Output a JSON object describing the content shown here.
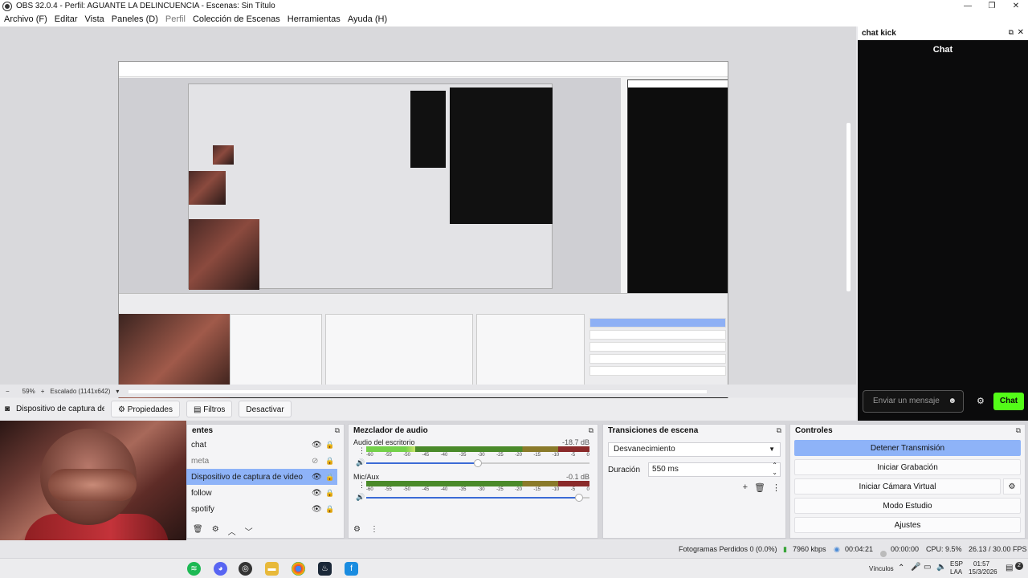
{
  "window": {
    "title": "OBS 32.0.4 - Perfil: AGUANTE LA DELINCUENCIA - Escenas: Sin Título",
    "controls": [
      "—",
      "❐",
      "✕"
    ]
  },
  "menu": {
    "items": [
      "Archivo (F)",
      "Editar",
      "Vista",
      "Paneles (D)",
      "Perfil",
      "Colección de Escenas",
      "Herramientas",
      "Ayuda (H)"
    ]
  },
  "preview": {
    "zoom": "59%",
    "scale": "Escalado (1141x642)"
  },
  "chat_dock": {
    "header": "chat kick",
    "title": "Chat",
    "input_placeholder": "Enviar un mensaje",
    "send_label": "Chat"
  },
  "source_toolbar": {
    "source_name": "Dispositivo de captura de v",
    "properties": "Propiedades",
    "filters": "Filtros",
    "deactivate": "Desactivar"
  },
  "sources": {
    "header": "entes",
    "items": [
      {
        "name": "chat",
        "visible": true
      },
      {
        "name": "meta",
        "visible": false
      },
      {
        "name": "Dispositivo de captura de video",
        "visible": true,
        "selected": true
      },
      {
        "name": "follow",
        "visible": true
      },
      {
        "name": "spotify",
        "visible": true
      }
    ]
  },
  "mixer": {
    "header": "Mezclador de audio",
    "tracks": [
      {
        "name": "Audio del escritorio",
        "db": "-18.7 dB",
        "level": 0.22,
        "volume": 0.5
      },
      {
        "name": "Mic/Aux",
        "db": "-0.1 dB",
        "level": 0.0,
        "volume": 0.97
      }
    ],
    "ticks": [
      "-60",
      "-55",
      "-50",
      "-45",
      "-40",
      "-35",
      "-30",
      "-25",
      "-20",
      "-15",
      "-10",
      "-5",
      "0"
    ]
  },
  "transitions": {
    "header": "Transiciones de escena",
    "selected": "Desvanecimiento",
    "duration_label": "Duración",
    "duration_value": "550 ms"
  },
  "controls": {
    "header": "Controles",
    "stop_stream": "Detener Transmisión",
    "start_record": "Iniciar Grabación",
    "start_virtualcam": "Iniciar Cámara Virtual",
    "studio_mode": "Modo Estudio",
    "settings": "Ajustes"
  },
  "status": {
    "dropped": "Fotogramas Perdidos 0 (0.0%)",
    "bitrate": "7960 kbps",
    "stream_time": "00:04:21",
    "rec_time": "00:00:00",
    "cpu": "CPU: 9.5%",
    "fps": "26.13 / 30.00 FPS"
  },
  "taskbar": {
    "tray_links": "Vínculos",
    "lang": "ESP",
    "lang2": "LAA",
    "time": "01:57",
    "date": "15/3/2026",
    "notif": "2"
  }
}
